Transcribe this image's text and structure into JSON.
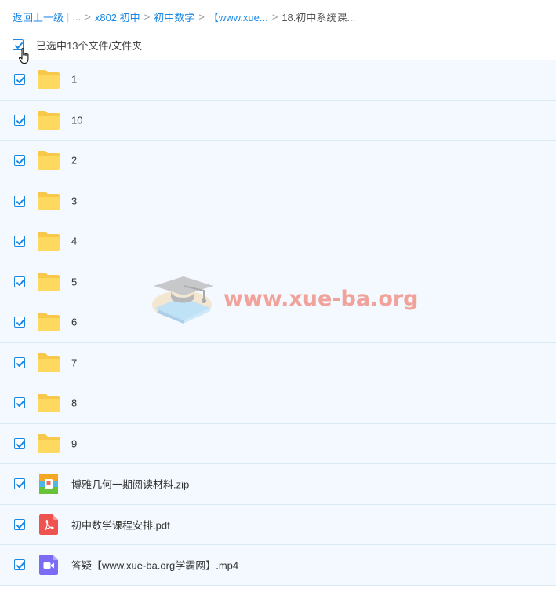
{
  "breadcrumb": {
    "back": "返回上一级",
    "bar": "|",
    "ellipsis": "...",
    "sep": ">",
    "items": [
      "x802 初中",
      "初中数学",
      "【www.xue...",
      "18.初中系统课..."
    ]
  },
  "selection": {
    "text": "已选中13个文件/文件夹",
    "checked": true
  },
  "files": [
    {
      "name": "1",
      "type": "folder",
      "checked": true
    },
    {
      "name": "10",
      "type": "folder",
      "checked": true
    },
    {
      "name": "2",
      "type": "folder",
      "checked": true
    },
    {
      "name": "3",
      "type": "folder",
      "checked": true
    },
    {
      "name": "4",
      "type": "folder",
      "checked": true
    },
    {
      "name": "5",
      "type": "folder",
      "checked": true
    },
    {
      "name": "6",
      "type": "folder",
      "checked": true
    },
    {
      "name": "7",
      "type": "folder",
      "checked": true
    },
    {
      "name": "8",
      "type": "folder",
      "checked": true
    },
    {
      "name": "9",
      "type": "folder",
      "checked": true
    },
    {
      "name": "博雅几何一期阅读材料.zip",
      "type": "zip",
      "checked": true
    },
    {
      "name": "初中数学课程安排.pdf",
      "type": "pdf",
      "checked": true
    },
    {
      "name": "答疑【www.xue-ba.org学霸网】.mp4",
      "type": "video",
      "checked": true
    }
  ],
  "watermark": {
    "text": "www.xue-ba.org"
  },
  "colors": {
    "accent": "#1b87e5",
    "row_bg": "#f3f9fe",
    "folder": "#ffd25a",
    "pdf": "#ef5350",
    "video": "#7b6cf6",
    "watermark": "#ef6a5a"
  }
}
